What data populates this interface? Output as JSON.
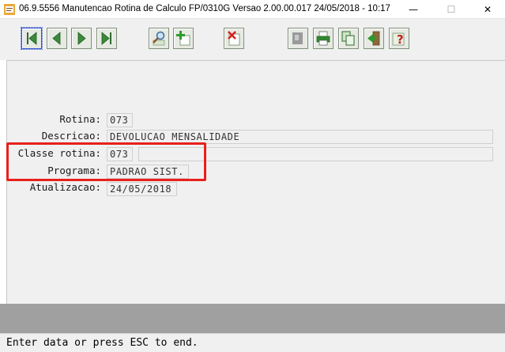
{
  "window": {
    "title": "06.9.5556 Manutencao  Rotina de Calculo FP/0310G Versao 2.00.00.017 24/05/2018 - 10:17",
    "minimize_glyph": "—",
    "maximize_glyph": "☐",
    "close_glyph": "✕"
  },
  "toolbar": {
    "buttons": [
      {
        "name": "first-record",
        "icon": "first-record-icon"
      },
      {
        "name": "previous-record",
        "icon": "previous-icon"
      },
      {
        "name": "next-record",
        "icon": "next-icon"
      },
      {
        "name": "last-record",
        "icon": "last-record-icon"
      },
      {
        "name": "search",
        "icon": "magnifier-icon"
      },
      {
        "name": "add",
        "icon": "add-icon"
      },
      {
        "name": "delete",
        "icon": "delete-icon"
      },
      {
        "name": "disabled-function",
        "icon": "disabled-icon"
      },
      {
        "name": "print",
        "icon": "printer-icon"
      },
      {
        "name": "copy",
        "icon": "copy-icon"
      },
      {
        "name": "exit",
        "icon": "exit-icon"
      },
      {
        "name": "help",
        "icon": "help-icon"
      }
    ]
  },
  "form": {
    "rotina": {
      "label": "Rotina:",
      "value": "073"
    },
    "descricao": {
      "label": "Descricao:",
      "value": "DEVOLUCAO MENSALIDADE"
    },
    "classe_rotina": {
      "label": "Classe rotina:",
      "value": "073",
      "description": ""
    },
    "programa": {
      "label": "Programa:",
      "value": "PADRAO SIST."
    },
    "atualizacao": {
      "label": "Atualizacao:",
      "value": "24/05/2018"
    }
  },
  "status": {
    "message": "Enter data or press ESC to end."
  },
  "colors": {
    "highlight": "#e8201c",
    "toolbar_green": "#3a8a3a",
    "background": "#f0f0f0"
  }
}
